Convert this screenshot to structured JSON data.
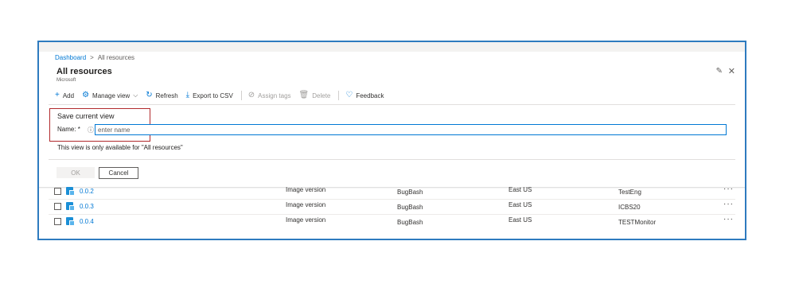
{
  "breadcrumb": {
    "home": "Dashboard",
    "separator": ">",
    "current": "All resources"
  },
  "header": {
    "title": "All resources",
    "subtitle": "Microsoft",
    "pin_icon": "pin-icon",
    "close_icon": "close-icon"
  },
  "toolbar": {
    "items": [
      {
        "icon": "+",
        "label": "Add",
        "enabled": true
      },
      {
        "icon": "⚙",
        "label": "Manage view",
        "chevron": "⌵",
        "enabled": true
      },
      {
        "icon": "↻",
        "label": "Refresh",
        "enabled": true
      },
      {
        "icon": "⤓",
        "label": "Export to CSV",
        "enabled": true
      },
      {
        "icon": "⊘",
        "label": "Assign tags",
        "enabled": false
      },
      {
        "icon": "🗑",
        "label": "Delete",
        "enabled": false
      },
      {
        "icon": "♡",
        "label": "Feedback",
        "enabled": true
      }
    ]
  },
  "save_view": {
    "heading": "Save current view",
    "name_label": "Name: *",
    "info_icon": "ⓘ",
    "name_placeholder": "enter name",
    "name_value": "",
    "note": "This view is only available for \"All resources\"",
    "ok_label": "OK",
    "cancel_label": "Cancel"
  },
  "rows": [
    {
      "name": "0.0.2",
      "type": "Image version",
      "resource_group": "BugBash",
      "location": "East US",
      "subscription": "TestEng",
      "more": "···"
    },
    {
      "name": "0.0.3",
      "type": "Image version",
      "resource_group": "BugBash",
      "location": "East US",
      "subscription": "ICBS20",
      "more": "···"
    },
    {
      "name": "0.0.4",
      "type": "Image version",
      "resource_group": "BugBash",
      "location": "East US",
      "subscription": "TESTMonitor",
      "more": "···"
    }
  ],
  "colors": {
    "accent": "#0078d4",
    "frame_border": "#2e7bbf",
    "highlight": "#b1292c"
  }
}
